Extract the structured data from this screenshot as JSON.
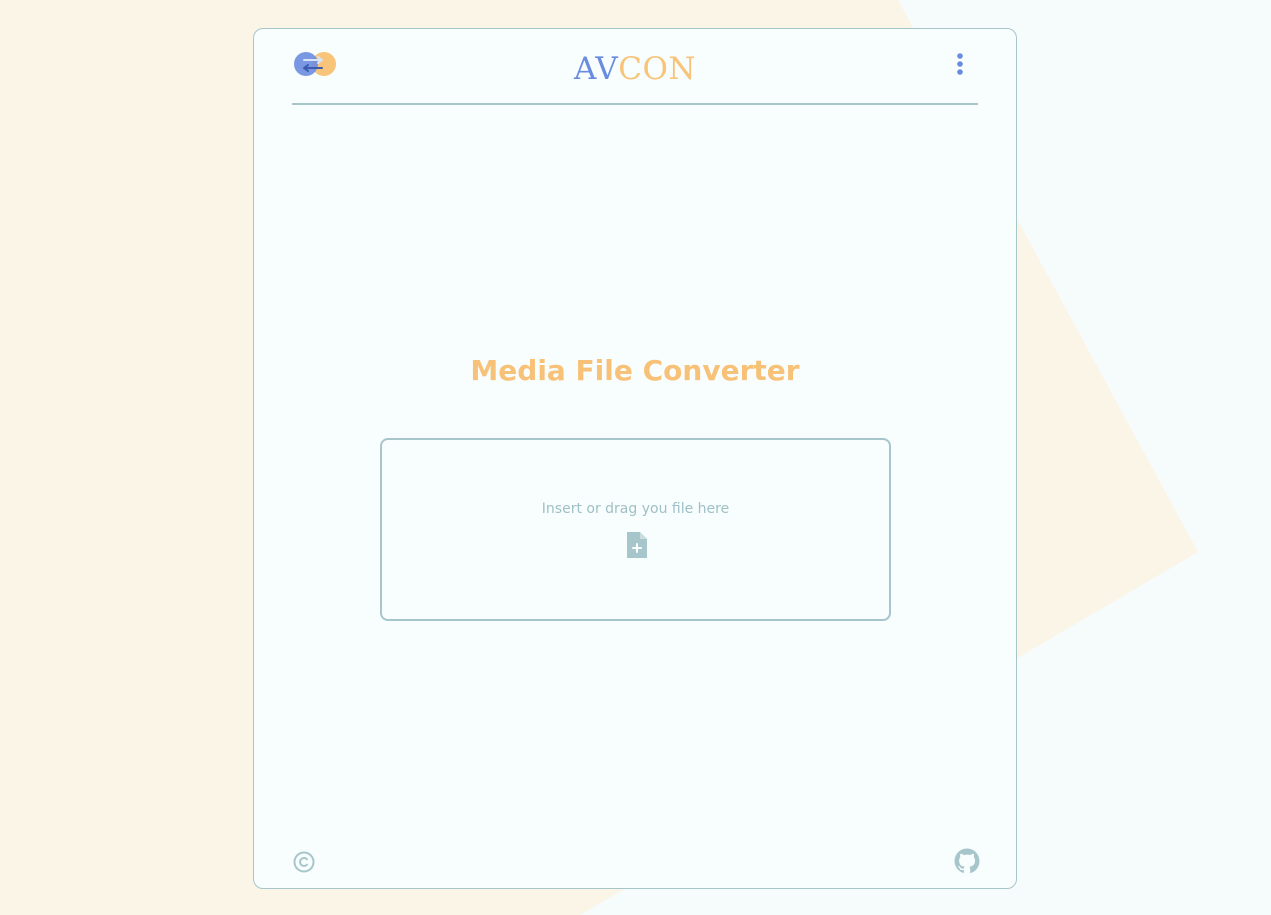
{
  "header": {
    "brand_part1": "AV",
    "brand_part2": "CON",
    "logo_icon": "convert-arrows-icon",
    "menu_icon": "kebab-menu-icon"
  },
  "main": {
    "title": "Media File Converter",
    "dropzone": {
      "text": "Insert or drag you file here",
      "icon": "file-add-icon"
    }
  },
  "footer": {
    "left_icon": "copyright-icon",
    "right_icon": "github-icon"
  },
  "colors": {
    "background": "#fbf5e8",
    "card": "#f8fdfd",
    "border": "#a7c6cc",
    "accent_blue": "#6a8ce0",
    "accent_orange": "#f7c47a"
  }
}
